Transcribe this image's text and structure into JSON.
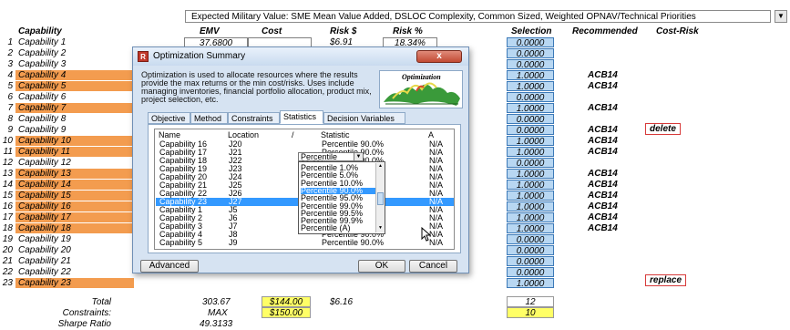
{
  "top_bar": {
    "selected_value": "Expected Military Value: SME Mean Value Added, DSLOC Complexity, Common Sized, Weighted OPNAV/Technical Priorities"
  },
  "headers": {
    "capability": "Capability",
    "emv": "EMV",
    "cost": "Cost",
    "risk_dollar": "Risk $",
    "risk_pct": "Risk %",
    "selection": "Selection",
    "recommended": "Recommended",
    "cost_risk": "Cost-Risk"
  },
  "first_row": {
    "emv": "37.6800",
    "risk_dollar": "$6.91",
    "risk_pct": "18.34%"
  },
  "rows": [
    {
      "num": "1",
      "name": "Capability 1",
      "orange": false,
      "selection": "0.0000",
      "rec": ""
    },
    {
      "num": "2",
      "name": "Capability 2",
      "orange": false,
      "selection": "0.0000",
      "rec": ""
    },
    {
      "num": "3",
      "name": "Capability 3",
      "orange": false,
      "selection": "0.0000",
      "rec": ""
    },
    {
      "num": "4",
      "name": "Capability 4",
      "orange": true,
      "selection": "1.0000",
      "rec": "ACB14"
    },
    {
      "num": "5",
      "name": "Capability 5",
      "orange": true,
      "selection": "1.0000",
      "rec": "ACB14"
    },
    {
      "num": "6",
      "name": "Capability 6",
      "orange": false,
      "selection": "0.0000",
      "rec": ""
    },
    {
      "num": "7",
      "name": "Capability 7",
      "orange": true,
      "selection": "1.0000",
      "rec": "ACB14"
    },
    {
      "num": "8",
      "name": "Capability 8",
      "orange": false,
      "selection": "0.0000",
      "rec": ""
    },
    {
      "num": "9",
      "name": "Capability 9",
      "orange": false,
      "selection": "0.0000",
      "rec": "ACB14"
    },
    {
      "num": "10",
      "name": "Capability 10",
      "orange": true,
      "selection": "1.0000",
      "rec": "ACB14"
    },
    {
      "num": "11",
      "name": "Capability 11",
      "orange": true,
      "selection": "1.0000",
      "rec": "ACB14"
    },
    {
      "num": "12",
      "name": "Capability 12",
      "orange": false,
      "selection": "0.0000",
      "rec": ""
    },
    {
      "num": "13",
      "name": "Capability 13",
      "orange": true,
      "selection": "1.0000",
      "rec": "ACB14"
    },
    {
      "num": "14",
      "name": "Capability 14",
      "orange": true,
      "selection": "1.0000",
      "rec": "ACB14"
    },
    {
      "num": "15",
      "name": "Capability 15",
      "orange": true,
      "selection": "1.0000",
      "rec": "ACB14"
    },
    {
      "num": "16",
      "name": "Capability 16",
      "orange": true,
      "selection": "1.0000",
      "rec": "ACB14"
    },
    {
      "num": "17",
      "name": "Capability 17",
      "orange": true,
      "selection": "1.0000",
      "rec": "ACB14"
    },
    {
      "num": "18",
      "name": "Capability 18",
      "orange": true,
      "selection": "1.0000",
      "rec": "ACB14"
    },
    {
      "num": "19",
      "name": "Capability 19",
      "orange": false,
      "selection": "0.0000",
      "rec": ""
    },
    {
      "num": "20",
      "name": "Capability 20",
      "orange": false,
      "selection": "0.0000",
      "rec": ""
    },
    {
      "num": "21",
      "name": "Capability 21",
      "orange": false,
      "selection": "0.0000",
      "rec": ""
    },
    {
      "num": "22",
      "name": "Capability 22",
      "orange": false,
      "selection": "0.0000",
      "rec": ""
    },
    {
      "num": "23",
      "name": "Capability 23",
      "orange": true,
      "selection": "1.0000",
      "rec": ""
    }
  ],
  "cost_risk": {
    "delete_label": "delete",
    "replace_label": "replace"
  },
  "totals": {
    "total_label": "Total",
    "total_emv": "303.67",
    "total_cost": "$144.00",
    "total_risk": "$6.16",
    "total_selection": "12",
    "constraints_label": "Constraints:",
    "constraints_emv": "MAX",
    "constraints_cost": "$150.00",
    "constraints_selection": "10",
    "sharpe_label": "Sharpe Ratio",
    "sharpe_value": "49.3133"
  },
  "colors": {
    "orange": "#f39c4f",
    "selection_blue": "#b8d7f2",
    "yellow": "#ffff66",
    "delete_border": "#d73a3a"
  },
  "dialog": {
    "title": "Optimization Summary",
    "close_label": "x",
    "description": "Optimization is used to allocate resources where the results provide the max returns or the min cost/risks. Uses include managing inventories, financial portfolio allocation, product mix, project selection, etc.",
    "banner_label": "Optimization",
    "tabs": [
      "Objective",
      "Method",
      "Constraints",
      "Statistics",
      "Decision Variables"
    ],
    "active_tab": "Statistics",
    "columns": [
      "Name",
      "Location",
      "/",
      "Statistic",
      "A"
    ],
    "list_rows": [
      [
        "Capability 16",
        "J20",
        "Percentile 90.0%",
        "N/A"
      ],
      [
        "Capability 17",
        "J21",
        "Percentile 90.0%",
        "N/A"
      ],
      [
        "Capability 18",
        "J22",
        "Percentile 90.0%",
        "N/A"
      ],
      [
        "Capability 19",
        "J23",
        "Percentile 90.0%",
        "N/A"
      ],
      [
        "Capability 20",
        "J24",
        "Percentile 90.0%",
        "N/A"
      ],
      [
        "Capability 21",
        "J25",
        "Percentile 90.0%",
        "N/A"
      ],
      [
        "Capability 22",
        "J26",
        "Percentile 90.0%",
        "N/A"
      ],
      [
        "Capability 23",
        "J27",
        "Percentile 90.0%",
        "N/A"
      ],
      [
        "Capability 1",
        "J5",
        "Percentile 90.0%",
        "N/A"
      ],
      [
        "Capability 2",
        "J6",
        "Percentile 90.0%",
        "N/A"
      ],
      [
        "Capability 3",
        "J7",
        "Percentile 90.0%",
        "N/A"
      ],
      [
        "Capability 4",
        "J8",
        "Percentile 90.0%",
        "N/A"
      ],
      [
        "Capability 5",
        "J9",
        "Percentile 90.0%",
        "N/A"
      ]
    ],
    "selected_list_index": 7,
    "combo_value": "Percentile 90.0%",
    "dropdown_options": [
      "Percentile 1.0%",
      "Percentile 5.0%",
      "Percentile 10.0%",
      "Percentile 90.0%",
      "Percentile 95.0%",
      "Percentile 99.0%",
      "Percentile 99.5%",
      "Percentile 99.9%",
      "Percentile (A)"
    ],
    "dropdown_highlight_index": 3,
    "advanced_label": "Advanced",
    "ok_label": "OK",
    "cancel_label": "Cancel"
  }
}
